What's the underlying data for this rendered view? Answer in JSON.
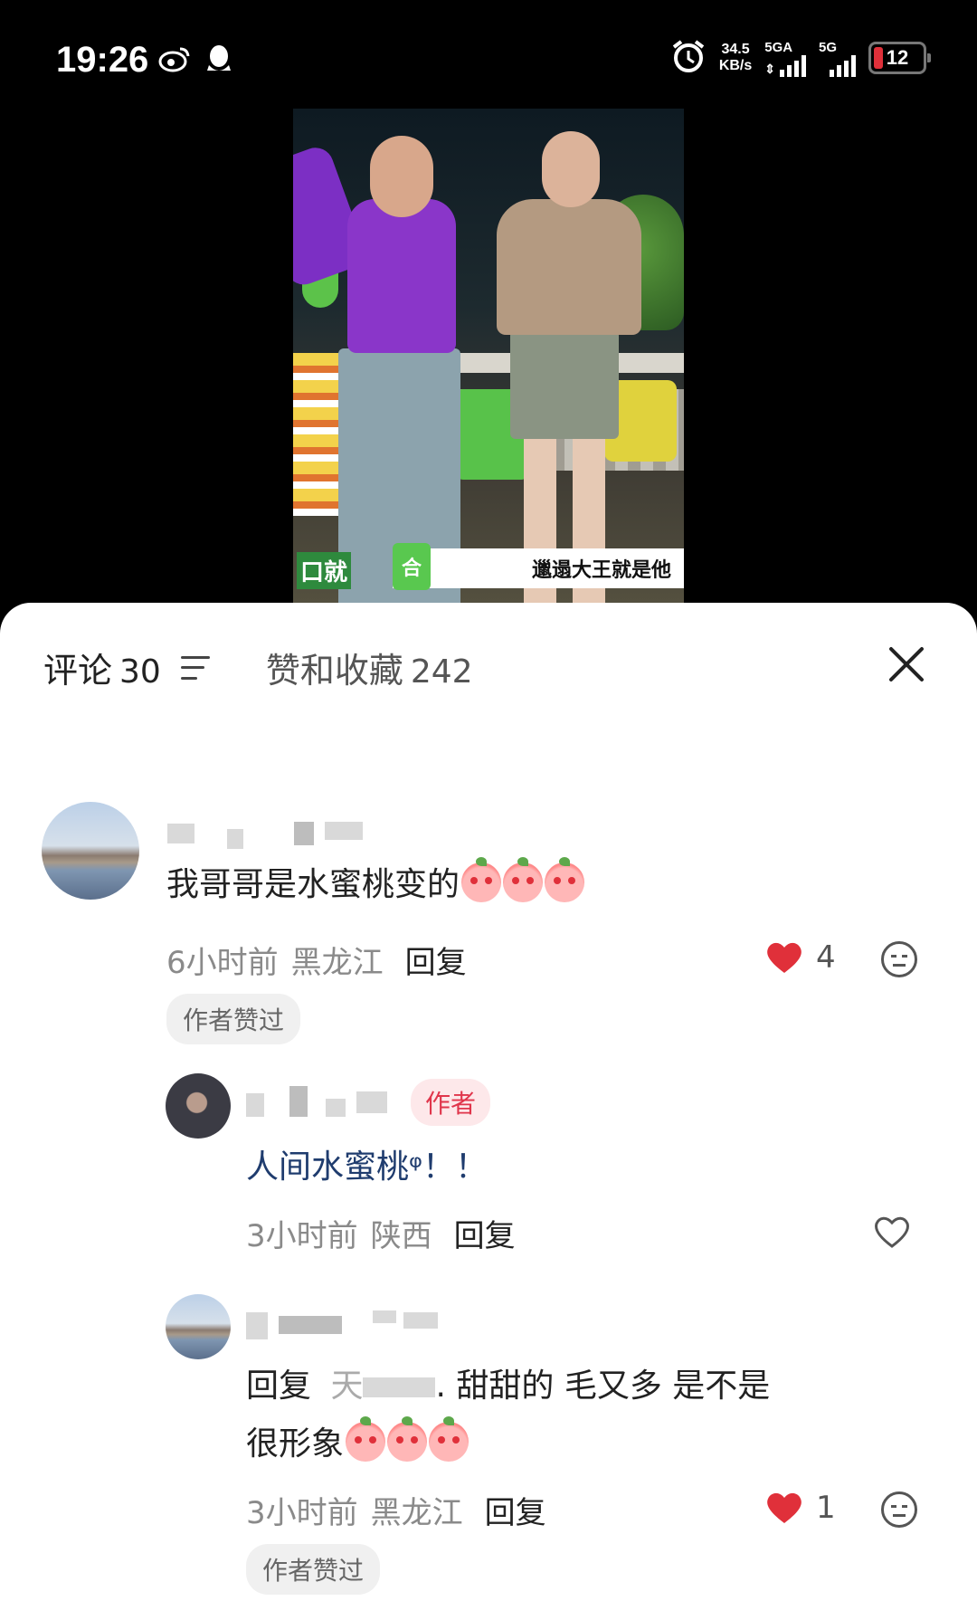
{
  "status_bar": {
    "time": "19:26",
    "net_speed_value": "34.5",
    "net_speed_unit": "KB/s",
    "sim1_label": "5GA",
    "sim2_label": "5G",
    "battery_level": "12",
    "icons": [
      "weibo-icon",
      "qq-icon",
      "alarm-icon"
    ]
  },
  "video": {
    "caption": "邋遢大王就是他",
    "badge": "合",
    "brand_text": "口就"
  },
  "panel": {
    "comments_tab_label": "评论",
    "comments_count": "30",
    "likes_tab_label": "赞和收藏",
    "likes_count": "242"
  },
  "comments": [
    {
      "text": "我哥哥是水蜜桃变的",
      "time": "6小时前",
      "location": "黑龙江",
      "reply_label": "回复",
      "likes": "4",
      "liked": true,
      "badge": "作者赞过"
    }
  ],
  "replies": [
    {
      "author_tag": "作者",
      "text": "人间水蜜桃ᵠ！！",
      "time": "3小时前",
      "location": "陕西",
      "reply_label": "回复"
    },
    {
      "reply_prefix": "回复",
      "reply_target": "天",
      "text_line1": ". 甜甜的 毛又多 是不是",
      "text_line2": "很形象",
      "time": "3小时前",
      "location": "黑龙江",
      "reply_label": "回复",
      "likes": "1",
      "liked": true,
      "badge": "作者赞过"
    }
  ],
  "colors": {
    "like_red": "#e0303a",
    "author_tag": "#e0354b"
  }
}
